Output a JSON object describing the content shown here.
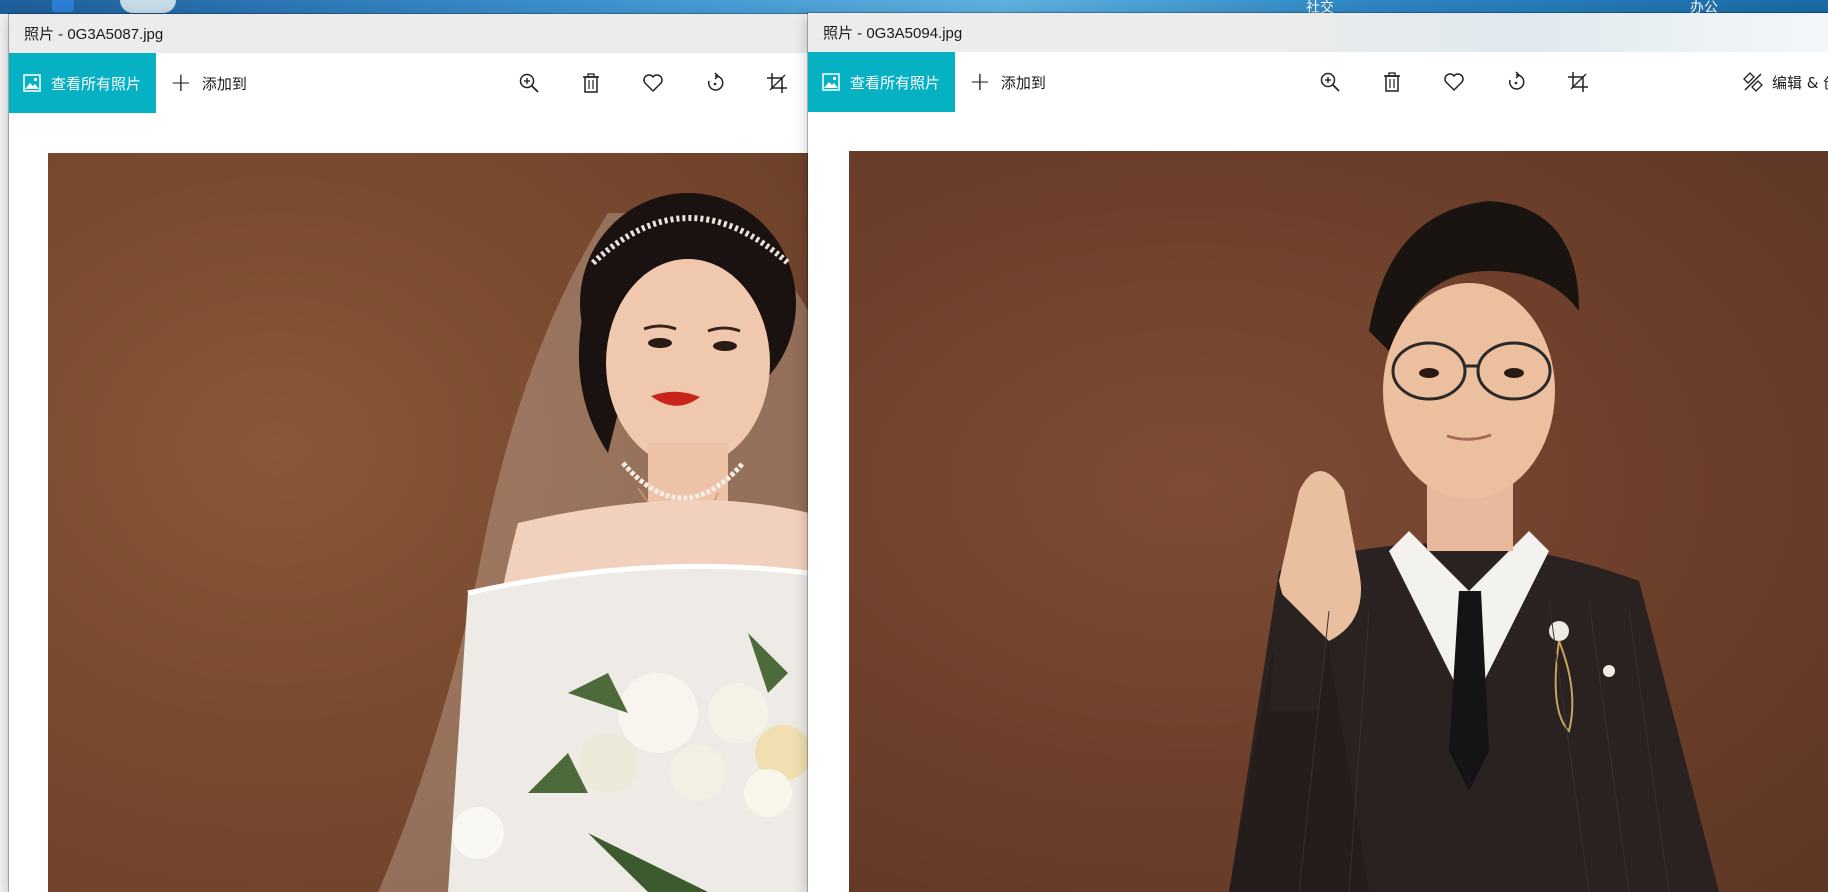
{
  "desktop": {
    "labels": [
      "社交",
      "办公"
    ]
  },
  "windows": [
    {
      "title": "照片 - 0G3A5087.jpg",
      "view_all_label": "查看所有照片",
      "add_to_label": "添加到"
    },
    {
      "title": "照片 - 0G3A5094.jpg",
      "view_all_label": "查看所有照片",
      "add_to_label": "添加到",
      "edit_label": "编辑 & 创"
    }
  ],
  "colors": {
    "accent": "#07b1c4",
    "photo_backdrop": "#7a4a30"
  },
  "icons": [
    "photo-icon",
    "zoom-in-icon",
    "delete-icon",
    "favorite-icon",
    "rotate-icon",
    "crop-icon",
    "edit-create-icon"
  ]
}
